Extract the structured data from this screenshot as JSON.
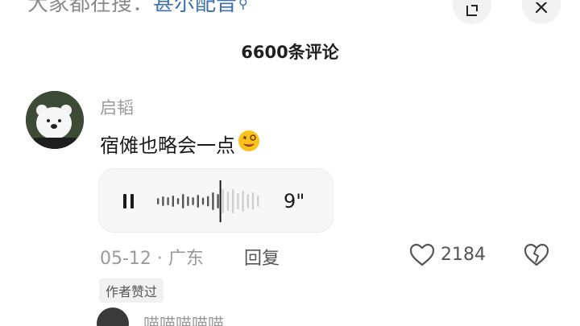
{
  "header": {
    "search_prefix": "大家都在搜：",
    "search_term": "甚尔配音",
    "search_term_icon": "search-icon",
    "open_icon": "open-in-icon",
    "close_icon": "close-icon"
  },
  "comments_header": {
    "count_label": "6600条评论"
  },
  "comment": {
    "username": "启韬",
    "text": "宿傩也略会一点",
    "emoji": "dizzy-face-emoji",
    "voice": {
      "duration": "9\"",
      "progress": 0.45,
      "state_icon": "pause-icon"
    },
    "date_location": "05-12 · 广东",
    "reply_label": "回复",
    "like_count": "2184",
    "author_badge": "作者赞过"
  },
  "reply_preview": {
    "username": "喵喵喵喵喵"
  },
  "colors": {
    "link": "#3a6fb0",
    "muted_text": "#9a9a9a",
    "bubble_bg": "#f7f7f7"
  }
}
